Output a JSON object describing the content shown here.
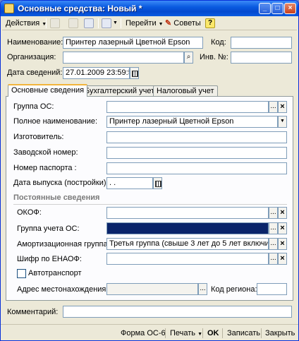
{
  "window": {
    "title": "Основные средства: Новый *",
    "title_icon": "document-icon"
  },
  "toolbar": {
    "actions_label": "Действия",
    "goto_label": "Перейти",
    "tips_label": "Советы",
    "help_label": "?"
  },
  "header": {
    "name_label": "Наименование:",
    "name_value": "Принтер лазерный Цветной Epson",
    "code_label": "Код:",
    "code_value": "",
    "org_label": "Организация:",
    "org_value": "",
    "inv_label": "Инв. №:",
    "inv_value": "",
    "date_label": "Дата сведений:",
    "date_value": "27.01.2009 23:59:59"
  },
  "tabs": [
    {
      "label": "Основные сведения"
    },
    {
      "label": "Бухгалтерский учет"
    },
    {
      "label": "Налоговый учет"
    }
  ],
  "main": {
    "group_label": "Группа ОС:",
    "group_value": "",
    "full_name_label": "Полное наименование:",
    "full_name_value": "Принтер лазерный Цветной Epson",
    "maker_label": "Изготовитель:",
    "maker_value": "",
    "serial_label": "Заводской номер:",
    "serial_value": "",
    "passport_label": "Номер паспорта :",
    "passport_value": "",
    "release_label": "Дата выпуска (постройки):",
    "release_value": " .  .",
    "section_title": "Постоянные сведения",
    "okof_label": "ОКОФ:",
    "okof_value": "",
    "acc_group_label": "Группа учета ОС:",
    "acc_group_value": "",
    "amort_label": "Амортизационная группа:",
    "amort_value": "Третья группа (свыше 3 лет до 5 лет включитель",
    "enaof_label": "Шифр по ЕНАОФ:",
    "enaof_value": "",
    "auto_label": "Автотранспорт",
    "auto_checked": false,
    "address_label": "Адрес местонахождения:",
    "address_value": "",
    "region_label": "Код региона:",
    "region_value": ""
  },
  "footer": {
    "comment_label": "Комментарий:",
    "comment_value": "",
    "form_label": "Форма ОС-6",
    "print_label": "Печать",
    "ok_label": "OK",
    "save_label": "Записать",
    "close_label": "Закрыть"
  },
  "buttons": {
    "ellipsis": "...",
    "clear": "×",
    "search": "🔍",
    "dropdown": "▼"
  }
}
